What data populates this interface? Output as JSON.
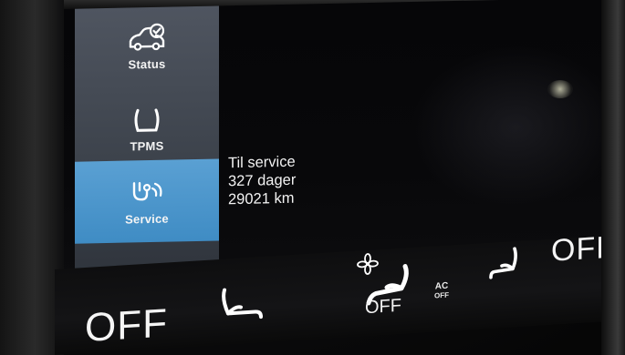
{
  "sidebar": {
    "items": [
      {
        "label": "Status",
        "icon": "car-check-icon",
        "selected": false
      },
      {
        "label": "TPMS",
        "icon": "tire-pressure-icon",
        "selected": false
      },
      {
        "label": "Service",
        "icon": "stethoscope-icon",
        "selected": true
      }
    ]
  },
  "service_info": {
    "line1": "Til service",
    "line2": "327 dager",
    "line3": "29021 km"
  },
  "climate_bar": {
    "left_temp_label": "OFF",
    "left_seat_heat_icon": "seat-heat-icon",
    "fan_icon": "fan-icon",
    "seat_ventilation_icon": "seat-ventilation-icon",
    "mid_off_label": "OFF",
    "ac_label": "AC",
    "ac_off_label": "OFF",
    "right_seat_heat_icon": "seat-heat-icon",
    "right_temp_label": "OFF"
  },
  "colors": {
    "selected_bg": "#4a97cc",
    "sidebar_bg": "#454b55",
    "text": "#ffffff"
  }
}
